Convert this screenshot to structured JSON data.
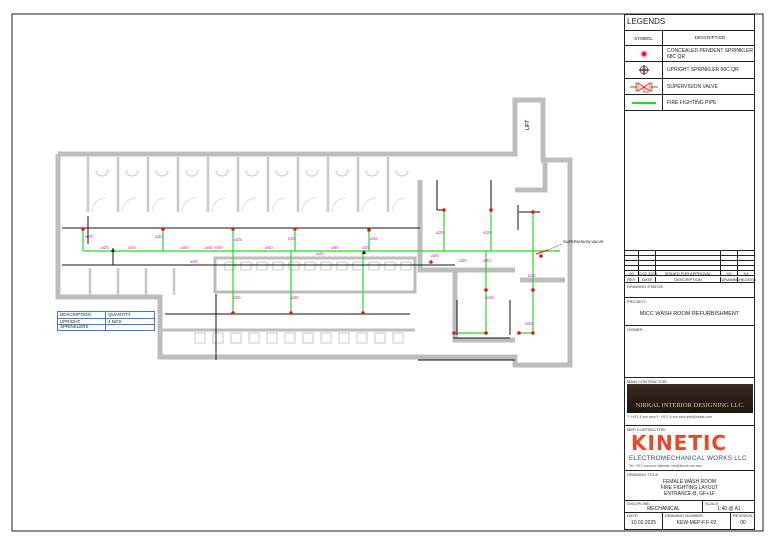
{
  "legend": {
    "title": "LEGENDS",
    "symbol_header": "SYMBOL",
    "description_header": "DESCRIPTION",
    "items": [
      {
        "icon": "concealed-pendent-sprinkler-icon",
        "label": "CONCEALED PENDENT SPRINKLER 68C QR"
      },
      {
        "icon": "upright-sprinkler-icon",
        "label": "UPRIGHT SPRINKLER 68C QR"
      },
      {
        "icon": "supervision-valve-icon",
        "label": "SUPERVISION VALVE"
      },
      {
        "icon": "fire-fighting-pipe-icon",
        "label": "FIRE FIGHTING PIPE"
      }
    ]
  },
  "revisions": {
    "headers": [
      "REV",
      "DATE",
      "DESCRIPTION",
      "DRAWN",
      "CHECKED"
    ],
    "rows": [
      [
        "00",
        "10.02.2025",
        "ISSUED FOR APPROVAL",
        "XX",
        "XX"
      ]
    ]
  },
  "drawing_status_label": "DRAWING STATUS:",
  "project": {
    "label": "PROJECT:",
    "value": "MICC WASH ROOM REFURBISHMENT"
  },
  "owner_label": "OWNER:",
  "main_contractor": {
    "label": "MAIN CONTRACTOR:",
    "name": "NIRKAL INTERIOR DESIGNING LLC.",
    "contact": "T: +971 4 xxx xxxx  F: +971 4 xxx xxxx  info@nirkal.com"
  },
  "mep_contractor": {
    "label": "MEP CONTRACTOR:",
    "logo": "KINETIC",
    "subtitle": "ELECTROMECHANICAL WORKS LLC",
    "contact": "Tel: +971 xxxxxxxx   Website: info@kinetic-me.com"
  },
  "drawing_title": {
    "label": "DRAWING TITLE:",
    "lines": [
      "FEMALE WASH ROOM",
      "FIRE FIGHTING LAYOUT",
      "ENTRANCE-B, GF+1F"
    ]
  },
  "discipline": {
    "label": "DISCIPLINE:",
    "value": "MECHANICAL"
  },
  "scale": {
    "label": "SCALE:",
    "value": "1:40 @ A1"
  },
  "date": {
    "label": "DATE:",
    "value": "10.02.2025"
  },
  "drawing_number": {
    "label": "DRAWING NUMBER:",
    "value": "KEW-MEP-F.F-02"
  },
  "revision": {
    "label": "REVISION:",
    "value": "00"
  },
  "plan": {
    "lift_label": "LIFT",
    "supervision_valve_label": "SUPERVISION VALVE",
    "quantity_table": {
      "headers": [
        "DESCRIPTION",
        "QUANTITY"
      ],
      "rows": [
        [
          "UPRIGHT SPRINKLERS",
          "4 NOS"
        ]
      ]
    },
    "pipe_labels": [
      "ø25",
      "ø25",
      "ø25",
      "ø32",
      "ø40",
      "ø40",
      "ø25",
      "ø50",
      "ø25",
      "ø50",
      "ø32",
      "ø25",
      "ø50",
      "ø32",
      "ø25",
      "ø25",
      "ø25",
      "ø25",
      "ø32",
      "ø25",
      "ø25",
      "ø25",
      "ø25",
      "ø25",
      "ø25"
    ]
  },
  "colors": {
    "pipe": "#22dd22",
    "sprinkler": "#ee1111",
    "label": "#dd22dd",
    "wall": "#bdbdbd"
  }
}
